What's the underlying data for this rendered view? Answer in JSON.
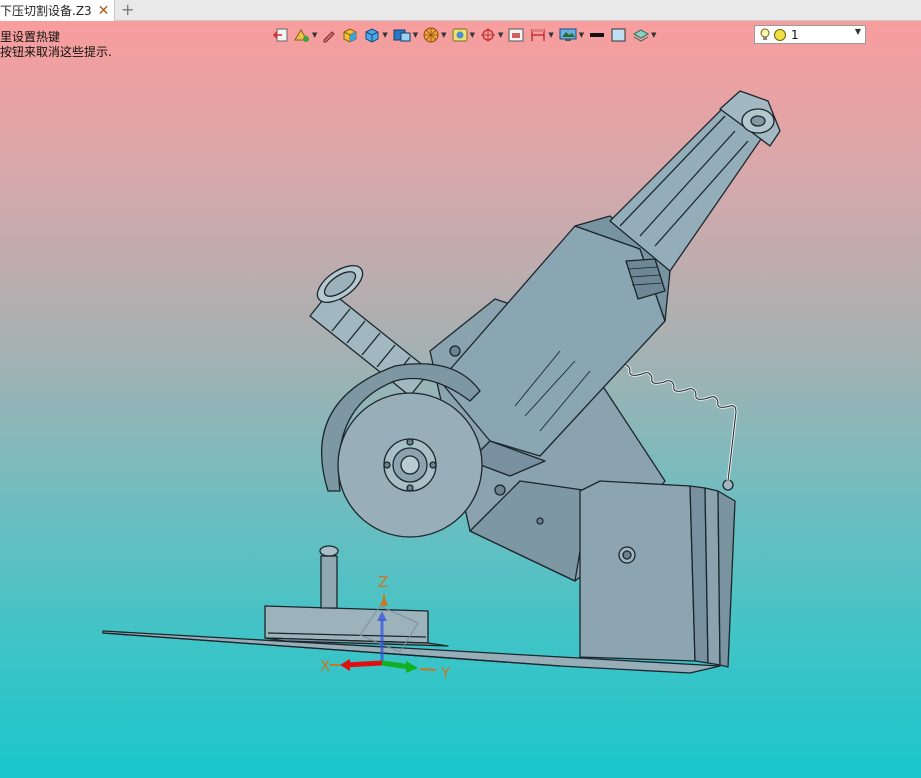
{
  "tab": {
    "title": "下压切割设备.Z3",
    "close_glyph": "✕",
    "add_glyph": "+"
  },
  "hints": {
    "line1": "里设置热键",
    "line2": "按钮来取消这些提示."
  },
  "toolbar": {
    "buttons": [
      {
        "icon": "exit-view-icon",
        "has_dropdown": false
      },
      {
        "icon": "render-mode-icon",
        "has_dropdown": true
      },
      {
        "icon": "pen-edit-icon",
        "has_dropdown": false
      },
      {
        "icon": "shaded-cube-icon",
        "has_dropdown": false
      },
      {
        "icon": "view-cube-icon",
        "has_dropdown": true
      },
      {
        "icon": "standard-views-icon",
        "has_dropdown": true
      },
      {
        "icon": "color-wheel-icon",
        "has_dropdown": true
      },
      {
        "icon": "filter-icon",
        "has_dropdown": true
      },
      {
        "icon": "snap-target-icon",
        "has_dropdown": true
      },
      {
        "icon": "frame-icon",
        "has_dropdown": false
      },
      {
        "icon": "measure-icon",
        "has_dropdown": true
      },
      {
        "icon": "display-settings-icon",
        "has_dropdown": true
      },
      {
        "icon": "line-color-icon",
        "has_dropdown": false
      },
      {
        "icon": "fill-color-icon",
        "has_dropdown": false
      },
      {
        "icon": "layer-icon",
        "has_dropdown": true
      }
    ],
    "layer_combo": {
      "value": "1",
      "icons": [
        "light-bulb-icon",
        "yellow-dot-icon"
      ]
    }
  },
  "triad": {
    "x_label": "X",
    "y_label": "Y",
    "z_label": "Z"
  },
  "colors": {
    "bg_top": "#f99d9d",
    "bg_bottom": "#19c6ca",
    "model_fill": "#8fa9b4",
    "model_stroke": "#1b262c",
    "axis_x": "#e01010",
    "axis_y": "#10b020",
    "axis_z": "#3050e0",
    "axis_label": "#c8781e"
  }
}
